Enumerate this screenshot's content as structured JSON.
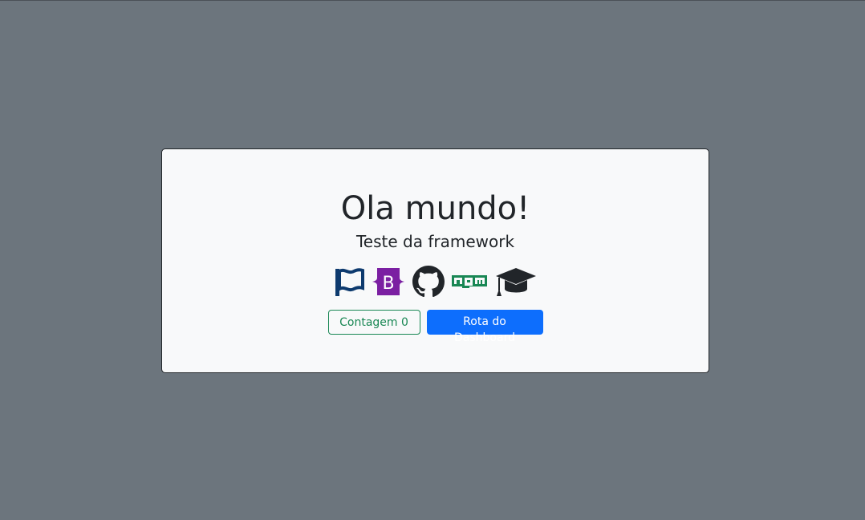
{
  "card": {
    "title": "Ola mundo!",
    "subtitle": "Teste da framework"
  },
  "icons": [
    {
      "name": "flag-icon",
      "color": "#0d3a6e"
    },
    {
      "name": "bootstrap-icon",
      "color": "#7b1fa2"
    },
    {
      "name": "github-icon",
      "color": "#212529"
    },
    {
      "name": "npm-icon",
      "color": "#198754"
    },
    {
      "name": "graduation-cap-icon",
      "color": "#212529"
    }
  ],
  "buttons": {
    "counter_label": "Contagem 0",
    "dashboard_label": "Rota do Dashboard"
  },
  "colors": {
    "background": "#6c757d",
    "card": "#f8f9fa",
    "success": "#198754",
    "primary": "#0d6efd"
  }
}
